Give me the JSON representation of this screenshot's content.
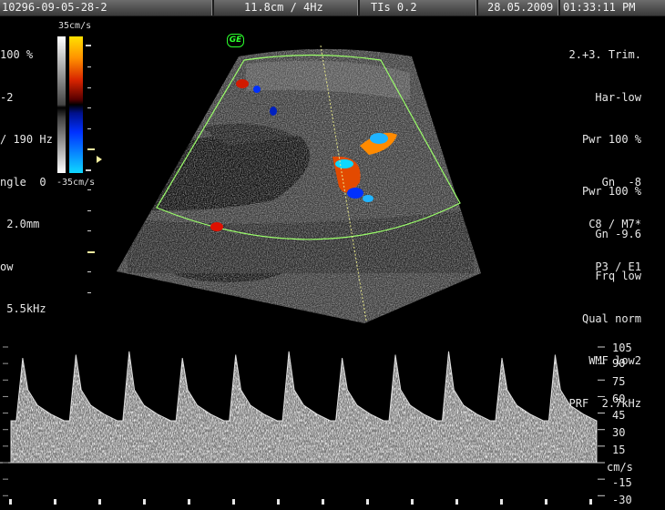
{
  "titlebar": {
    "patient_id": "10296-09-05-28-2",
    "depth_freq": "11.8cm / 4Hz",
    "tis": "TIs  0.2",
    "date": "28.05.2009",
    "time": "01:33:11 PM"
  },
  "left_params": [
    "100 %",
    "-2",
    "/ 190 Hz",
    "ngle  0",
    " 2.0mm",
    "ow",
    " 5.5kHz"
  ],
  "colorbar": {
    "top_label": "35cm/s",
    "bottom_label": "-35cm/s"
  },
  "logo": "GE",
  "right_params_1": [
    "2.+3. Trim.",
    "Har-low",
    "Pwr 100 %",
    "Gn  -8",
    "C8 / M7*",
    "P3 / E1"
  ],
  "right_params_2": [
    "Pwr 100 %",
    "Gn -9.6",
    "Frq low",
    "Qual norm",
    "WMF low2",
    "PRF  2.7kHz"
  ],
  "doppler": {
    "scale_labels": [
      "105",
      "90",
      "75",
      "60",
      "45",
      "30",
      "15",
      "-15",
      "-30"
    ],
    "unit": "cm/s",
    "scale_max": 105,
    "scale_min": -30,
    "baseline": 0,
    "cycles": 11
  },
  "colors": {
    "sector_outline": "#7cff4a",
    "color_box": "#9bff6a",
    "logo": "#2cff2c"
  }
}
